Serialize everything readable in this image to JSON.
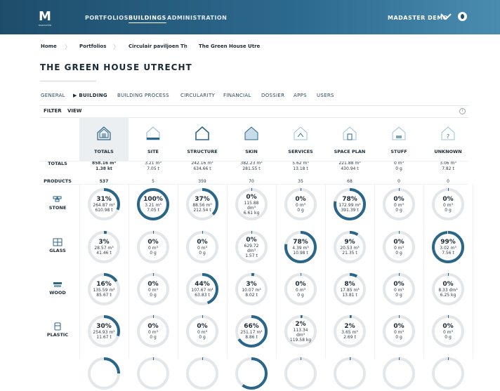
{
  "header": {
    "logo_text": "M",
    "logo_sub": "MADASTER",
    "nav": [
      "PORTFOLIOS",
      "BUILDINGS",
      "ADMINISTRATION"
    ],
    "active_nav": "BUILDINGS",
    "user": "MADASTER DEMO"
  },
  "breadcrumb": [
    "Home",
    "Portfolios",
    "Circulair paviljoen Th",
    "The Green House Utre"
  ],
  "page_title": "THE GREEN HOUSE UTRECHT",
  "tabs": [
    "GENERAL",
    "▶ BUILDING",
    "BUILDING PROCESS",
    "CIRCULARITY",
    "FINANCIAL",
    "DOSSIER",
    "APPS",
    "USERS"
  ],
  "filterbar": {
    "filter": "FILTER",
    "view": "VIEW",
    "info": "i"
  },
  "columns": [
    "TOTALS",
    "SITE",
    "STRUCTURE",
    "SKIN",
    "SERVICES",
    "SPACE PLAN",
    "STUFF",
    "UNKNOWN"
  ],
  "totals_row": {
    "label": "TOTALS",
    "values": [
      [
        "858.16 m³",
        "1.38 kt"
      ],
      [
        "3.21 m³",
        "7.05 t"
      ],
      [
        "242.16 m³",
        "634.66 t"
      ],
      [
        "382.23 m³",
        "281.55 t"
      ],
      [
        "5.62 m³",
        "13.18 t"
      ],
      [
        "221.88 m³",
        "430.94 t"
      ],
      [
        "0 m³",
        "0 g"
      ],
      [
        "3.06 m³",
        "7.82 t"
      ]
    ]
  },
  "products_row": {
    "label": "PRODUCTS",
    "values": [
      "537",
      "5",
      "359",
      "70",
      "35",
      "68",
      "0",
      "0"
    ]
  },
  "materials": [
    {
      "name": "STONE",
      "cells": [
        {
          "pct": 31,
          "pct_text": "31%",
          "lines": [
            "264.87 m³",
            "610.98 t"
          ]
        },
        {
          "pct": 100,
          "pct_text": "100%",
          "lines": [
            "3.21 m³",
            "7.05 t"
          ]
        },
        {
          "pct": 37,
          "pct_text": "37%",
          "lines": [
            "88.56 m³",
            "212.54 t"
          ]
        },
        {
          "pct": 0,
          "pct_text": "0%",
          "lines": [
            "115.88",
            "dm³",
            "6.61 kg"
          ]
        },
        {
          "pct": 0,
          "pct_text": "0%",
          "lines": [
            "0 m³",
            "0 g"
          ]
        },
        {
          "pct": 78,
          "pct_text": "78%",
          "lines": [
            "172.99 m³",
            "391.39 t"
          ]
        },
        {
          "pct": 0,
          "pct_text": "0%",
          "lines": [
            "0 m³",
            "0 g"
          ]
        },
        {
          "pct": 0,
          "pct_text": "0%",
          "lines": [
            "0 m³",
            "0 g"
          ]
        }
      ]
    },
    {
      "name": "GLASS",
      "cells": [
        {
          "pct": 3,
          "pct_text": "3%",
          "lines": [
            "28.57 m³",
            "41.46 t"
          ]
        },
        {
          "pct": 0,
          "pct_text": "0%",
          "lines": [
            "0 m³",
            "0 g"
          ]
        },
        {
          "pct": 0,
          "pct_text": "0%",
          "lines": [
            "0 m³",
            "0 g"
          ]
        },
        {
          "pct": 0,
          "pct_text": "0%",
          "lines": [
            "629.72",
            "dm³",
            "1.57 t"
          ]
        },
        {
          "pct": 78,
          "pct_text": "78%",
          "lines": [
            "4.39 m³",
            "10.98 t"
          ]
        },
        {
          "pct": 9,
          "pct_text": "9%",
          "lines": [
            "20.53 m³",
            "21.35 t"
          ]
        },
        {
          "pct": 0,
          "pct_text": "0%",
          "lines": [
            "0 m³",
            "0 g"
          ]
        },
        {
          "pct": 99,
          "pct_text": "99%",
          "lines": [
            "3.02 m³",
            "7.56 t"
          ]
        }
      ]
    },
    {
      "name": "WOOD",
      "cells": [
        {
          "pct": 16,
          "pct_text": "16%",
          "lines": [
            "135.59 m³",
            "85.67 t"
          ]
        },
        {
          "pct": 0,
          "pct_text": "0%",
          "lines": [
            "0 m³",
            "0 g"
          ]
        },
        {
          "pct": 44,
          "pct_text": "44%",
          "lines": [
            "107.67 m³",
            "63.83 t"
          ]
        },
        {
          "pct": 3,
          "pct_text": "3%",
          "lines": [
            "10.07 m³",
            "8.02 t"
          ]
        },
        {
          "pct": 0,
          "pct_text": "0%",
          "lines": [
            "0 m³",
            "0 g"
          ]
        },
        {
          "pct": 8,
          "pct_text": "8%",
          "lines": [
            "17.85 m³",
            "13.81 t"
          ]
        },
        {
          "pct": 0,
          "pct_text": "0%",
          "lines": [
            "0 m³",
            "0 g"
          ]
        },
        {
          "pct": 0,
          "pct_text": "0%",
          "lines": [
            "8.33 dm³",
            "6.25 kg"
          ]
        }
      ]
    },
    {
      "name": "PLASTIC",
      "cells": [
        {
          "pct": 30,
          "pct_text": "30%",
          "lines": [
            "254.93 m³",
            "11.67 t"
          ]
        },
        {
          "pct": 0,
          "pct_text": "0%",
          "lines": [
            "0 m³",
            "0 g"
          ]
        },
        {
          "pct": 0,
          "pct_text": "0%",
          "lines": [
            "0 m³",
            "0 g"
          ]
        },
        {
          "pct": 66,
          "pct_text": "66%",
          "lines": [
            "251.17 m³",
            "8.86 t"
          ]
        },
        {
          "pct": 2,
          "pct_text": "2%",
          "lines": [
            "113.34",
            "dm³",
            "119.58 kg"
          ]
        },
        {
          "pct": 2,
          "pct_text": "2%",
          "lines": [
            "3.65 m³",
            "2.69 t"
          ]
        },
        {
          "pct": 0,
          "pct_text": "0%",
          "lines": [
            "0 m³",
            "0 g"
          ]
        },
        {
          "pct": 0,
          "pct_text": "0%",
          "lines": [
            "0 m³",
            "0 g"
          ]
        }
      ]
    }
  ],
  "next_row_partial": [
    {
      "pct": 25
    },
    {
      "pct": 0
    },
    {
      "pct": 0
    },
    {
      "pct": 60
    },
    {
      "pct": 0
    },
    {
      "pct": 1
    },
    {
      "pct": 0
    },
    {
      "pct": 0
    }
  ],
  "colors": {
    "header_bg": "#1e4d6b",
    "accent": "#2a6689",
    "ring_track": "#e4e7ea",
    "totals_col_bg": "#eceff1"
  },
  "icons": {
    "phases": [
      "house-totals-icon",
      "house-site-icon",
      "house-structure-icon",
      "house-skin-icon",
      "house-services-icon",
      "house-space-plan-icon",
      "house-stuff-icon",
      "house-unknown-icon"
    ],
    "materials": [
      "stone-icon",
      "glass-icon",
      "wood-icon",
      "plastic-icon"
    ]
  }
}
